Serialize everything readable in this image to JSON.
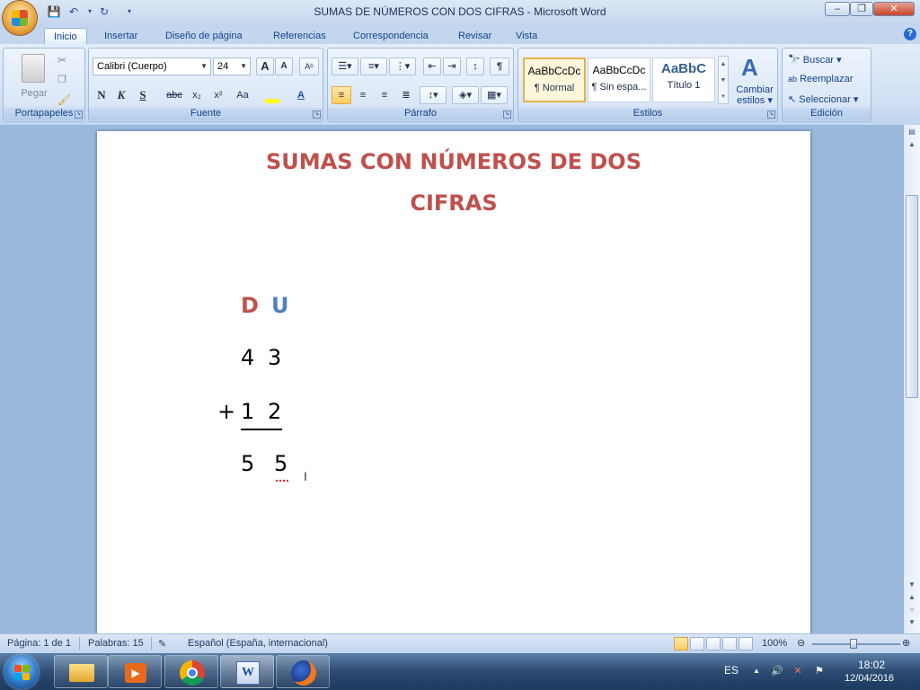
{
  "window": {
    "title": "SUMAS DE NÚMEROS CON DOS CIFRAS - Microsoft Word",
    "minimize_label": "–",
    "restore_label": "❐",
    "close_label": "✕",
    "help_label": "?"
  },
  "tabs": [
    "Inicio",
    "Insertar",
    "Diseño de página",
    "Referencias",
    "Correspondencia",
    "Revisar",
    "Vista"
  ],
  "ribbon": {
    "groups": {
      "clipboard": "Portapapeles",
      "font": "Fuente",
      "paragraph": "Párrafo",
      "styles": "Estilos",
      "editing": "Edición"
    },
    "paste_label": "Pegar",
    "font_name": "Calibri (Cuerpo)",
    "font_size": "24",
    "bold": "N",
    "italic": "K",
    "underline": "S",
    "strike": "abc",
    "subscript": "x₂",
    "superscript": "x²",
    "change_case": "Aa",
    "grow_font": "A",
    "shrink_font": "A",
    "styles": [
      {
        "sample": "AaBbCcDc",
        "name": "¶ Normal"
      },
      {
        "sample": "AaBbCcDc",
        "name": "¶ Sin espa..."
      },
      {
        "sample": "AaBbC",
        "name": "Título 1"
      }
    ],
    "change_styles_line1": "Cambiar",
    "change_styles_line2": "estilos",
    "find": "Buscar",
    "replace": "Reemplazar",
    "select": "Seleccionar"
  },
  "document": {
    "heading_line1": "SUMAS CON NÚMEROS DE DOS",
    "heading_line2": "CIFRAS",
    "col_d": "D",
    "col_u": "U",
    "row1_d": "4",
    "row1_u": "3",
    "plus": "+",
    "row2_d": "1",
    "row2_u": "2",
    "result_d": "5",
    "result_u": "5",
    "heading_color": "#c0504d",
    "u_color": "#4f81bd"
  },
  "status": {
    "page": "Página: 1 de 1",
    "words": "Palabras: 15",
    "language": "Español (España, internacional)",
    "zoom": "100%"
  },
  "taskbar": {
    "lang": "ES",
    "time": "18:02",
    "date": "12/04/2016",
    "apps": [
      "file-explorer",
      "media-player",
      "chrome",
      "word",
      "firefox"
    ]
  }
}
